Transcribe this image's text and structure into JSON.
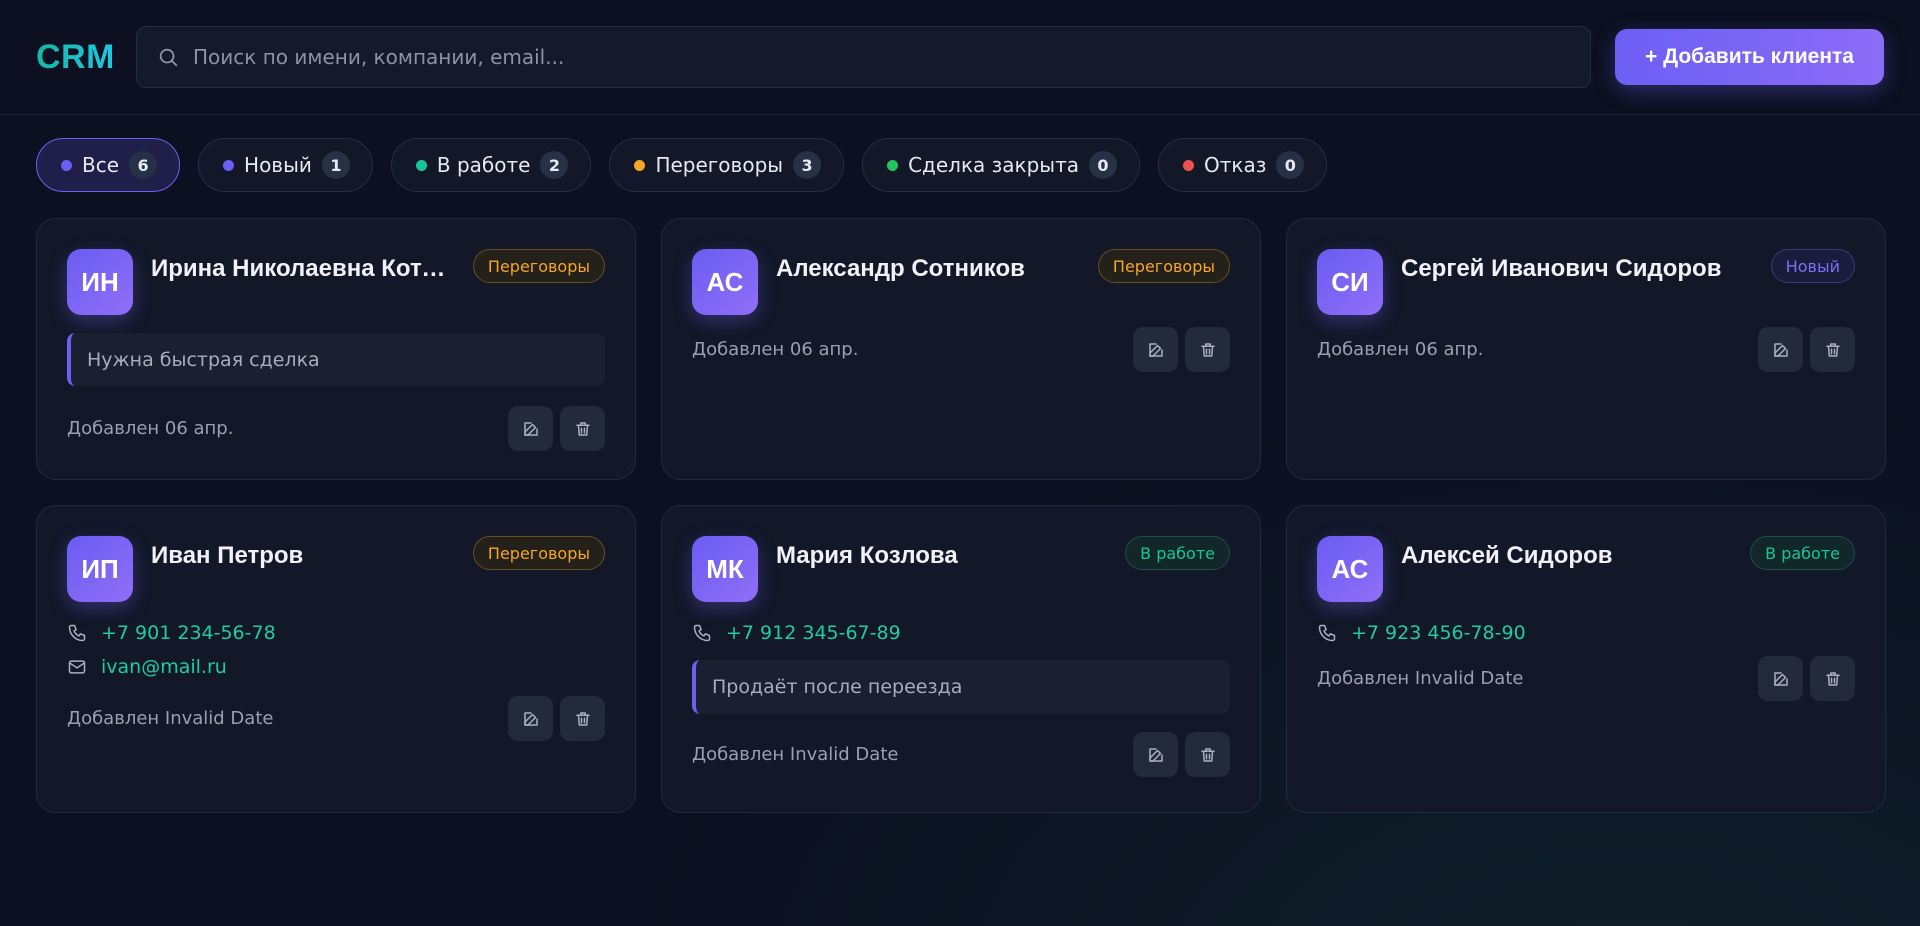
{
  "header": {
    "logo": "CRM",
    "search_placeholder": "Поиск по имени, компании, email...",
    "add_label": "+ Добавить клиента"
  },
  "filters": [
    {
      "label": "Все",
      "count": "6",
      "color": "#6c5ff4",
      "active": true
    },
    {
      "label": "Новый",
      "count": "1",
      "color": "#6c5ff4",
      "active": false
    },
    {
      "label": "В работе",
      "count": "2",
      "color": "#17c59b",
      "active": false
    },
    {
      "label": "Переговоры",
      "count": "3",
      "color": "#f5a623",
      "active": false
    },
    {
      "label": "Сделка закрыта",
      "count": "0",
      "color": "#22c55e",
      "active": false
    },
    {
      "label": "Отказ",
      "count": "0",
      "color": "#ef5350",
      "active": false
    }
  ],
  "clients": [
    {
      "initials": "ИН",
      "name": "Ирина Николаевна Кото...",
      "status": "Переговоры",
      "note": "Нужна быстрая сделка",
      "added": "Добавлен 06 апр."
    },
    {
      "initials": "АС",
      "name": "Александр Сотников",
      "status": "Переговоры",
      "added": "Добавлен 06 апр."
    },
    {
      "initials": "СИ",
      "name": "Сергей Иванович Сидоров",
      "status": "Новый",
      "added": "Добавлен 06 апр."
    },
    {
      "initials": "ИП",
      "name": "Иван Петров",
      "status": "Переговоры",
      "phone": "+7 901 234-56-78",
      "email": "ivan@mail.ru",
      "added": "Добавлен Invalid Date"
    },
    {
      "initials": "МК",
      "name": "Мария Козлова",
      "status": "В работе",
      "phone": "+7 912 345-67-89",
      "note": "Продаёт после переезда",
      "added": "Добавлен Invalid Date"
    },
    {
      "initials": "АС",
      "name": "Алексей Сидоров",
      "status": "В работе",
      "phone": "+7 923 456-78-90",
      "added": "Добавлен Invalid Date"
    }
  ],
  "colors": {
    "accent": "#6c5ff4",
    "teal": "#14b8a6",
    "orange": "#f5a623",
    "green": "#17c59b"
  },
  "icons": {
    "search": "search-icon",
    "phone": "phone-icon",
    "email": "mail-icon",
    "edit": "edit-icon",
    "delete": "trash-icon"
  }
}
